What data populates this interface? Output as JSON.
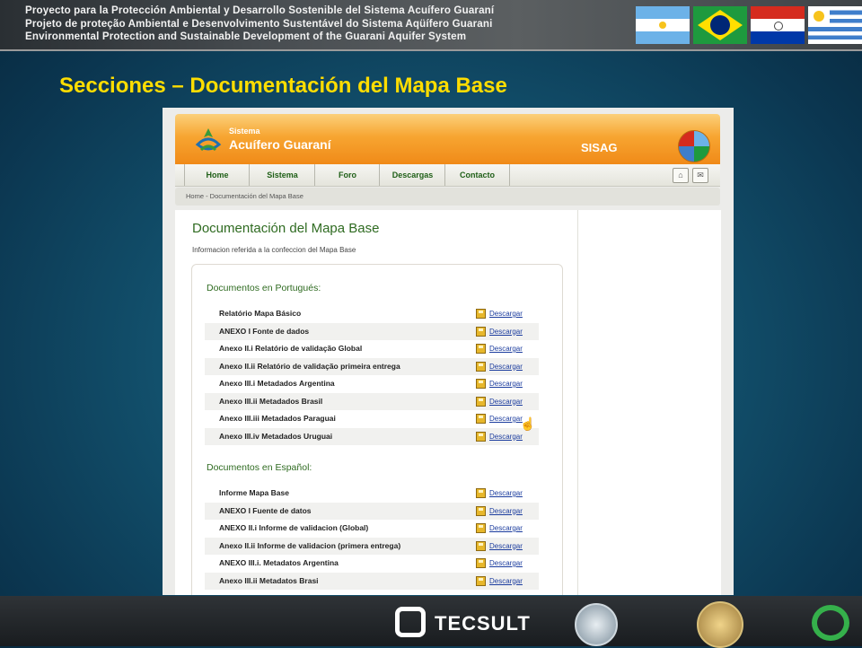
{
  "banner": {
    "lines": [
      "Proyecto para la Protección Ambiental y Desarrollo Sostenible del Sistema Acuífero Guaraní",
      "Projeto de proteção Ambiental e Desenvolvimento Sustentável do Sistema Aqüífero Guarani",
      "Environmental Protection and Sustainable Development of the Guarani Aquifer System"
    ]
  },
  "slide": {
    "title": "Secciones – Documentación del Mapa Base"
  },
  "site": {
    "logo_sub": "Sistema",
    "logo_main": "Acuífero Guaraní",
    "brand": "SISAG",
    "nav": [
      "Home",
      "Sistema",
      "Foro",
      "Descargas",
      "Contacto"
    ],
    "breadcrumb": "Home - Documentación del Mapa Base",
    "page_title": "Documentación del Mapa Base",
    "page_subtitle": "Informacion referida a la confeccion del Mapa Base",
    "download_label": "Descargar",
    "sections": [
      {
        "title": "Documentos en Portugués:",
        "items": [
          "Relatório Mapa Básico",
          "ANEXO I Fonte de dados",
          "Anexo II.i Relatório de validação Global",
          "Anexo II.ii Relatório de validação primeira entrega",
          "Anexo III.i Metadados Argentina",
          "Anexo III.ii Metadados Brasil",
          "Anexo III.iii Metadados Paraguai",
          "Anexo III.iv Metadados Uruguai"
        ]
      },
      {
        "title": "Documentos en Español:",
        "items": [
          "Informe Mapa Base",
          "ANEXO I Fuente de datos",
          "ANEXO II.i Informe de validacion (Global)",
          "Anexo II.ii Informe de validacion (primera entrega)",
          "ANEXO III.i. Metadatos Argentina",
          "Anexo III.ii Metadatos Brasi"
        ]
      }
    ]
  },
  "footer": {
    "tecsult": "TECSULT"
  }
}
